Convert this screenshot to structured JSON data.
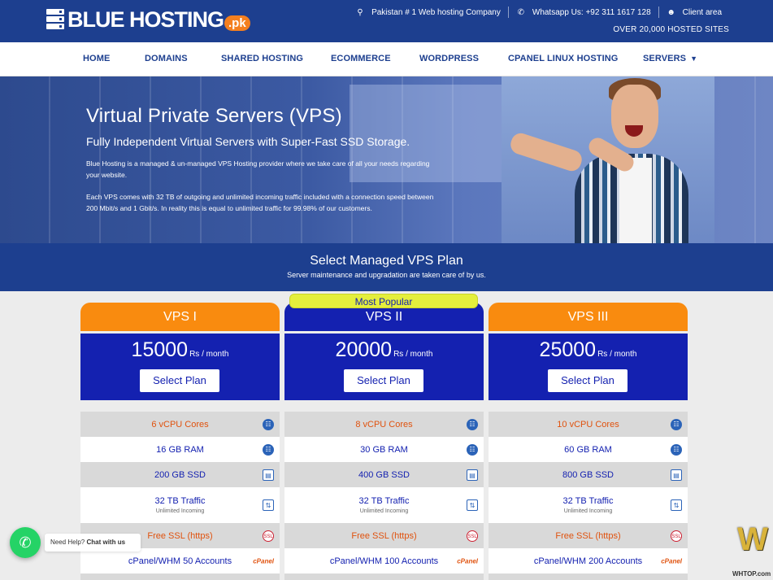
{
  "header": {
    "logo_text": "BLUE HOSTING",
    "logo_tld": ".pk",
    "top_links": [
      {
        "icon": "award-icon",
        "label": "Pakistan # 1 Web hosting Company"
      },
      {
        "icon": "whatsapp-icon",
        "label": "Whatsapp Us: +92 311 1617 128"
      },
      {
        "icon": "user-icon",
        "label": "Client area"
      }
    ],
    "hosted_text": "OVER 20,000 HOSTED SITES"
  },
  "nav": {
    "items": [
      "HOME",
      "DOMAINS",
      "SHARED HOSTING",
      "ECOMMERCE",
      "WORDPRESS",
      "CPANEL LINUX HOSTING",
      "SERVERS"
    ]
  },
  "hero": {
    "title": "Virtual Private Servers (VPS)",
    "subtitle": "Fully Independent Virtual Servers with Super-Fast SSD Storage.",
    "paragraph1": "Blue Hosting is a managed & un-managed VPS Hosting provider where we take care of all your needs regarding your website.",
    "paragraph2": "Each VPS comes with 32 TB of outgoing and unlimited incoming traffic included with a connection speed between 200 Mbit/s and 1 Gbit/s. In reality this is equal to unlimited traffic for 99.98% of our customers."
  },
  "plans_section": {
    "title": "Select Managed VPS Plan",
    "subtitle": "Server maintenance and upgradation are taken care of by us.",
    "popular_label": "Most Popular"
  },
  "plans": [
    {
      "name": "VPS I",
      "price": "15000",
      "unit": "Rs / month",
      "button": "Select Plan",
      "cpu": "6 vCPU Cores",
      "ram": "16 GB RAM",
      "ssd": "200 GB SSD",
      "traffic": "32 TB Traffic",
      "traffic_sub": "Unlimited Incoming",
      "ssl": "Free SSL (https)",
      "cpanel": "cPanel/WHM 50 Accounts"
    },
    {
      "name": "VPS II",
      "price": "20000",
      "unit": "Rs / month",
      "button": "Select Plan",
      "cpu": "8 vCPU Cores",
      "ram": "30 GB RAM",
      "ssd": "400 GB SSD",
      "traffic": "32 TB Traffic",
      "traffic_sub": "Unlimited Incoming",
      "ssl": "Free SSL (https)",
      "cpanel": "cPanel/WHM 100 Accounts"
    },
    {
      "name": "VPS III",
      "price": "25000",
      "unit": "Rs / month",
      "button": "Select Plan",
      "cpu": "10 vCPU Cores",
      "ram": "60 GB RAM",
      "ssd": "800 GB SSD",
      "traffic": "32 TB Traffic",
      "traffic_sub": "Unlimited Incoming",
      "ssl": "Free SSL (https)",
      "cpanel": "cPanel/WHM 200 Accounts"
    }
  ],
  "cpanel_logo_text": "cPanel",
  "whatsapp_widget": {
    "prefix": "Need Help?",
    "action": "Chat with us"
  },
  "watermark": {
    "mark": "W",
    "text": "WHTOP.com"
  }
}
